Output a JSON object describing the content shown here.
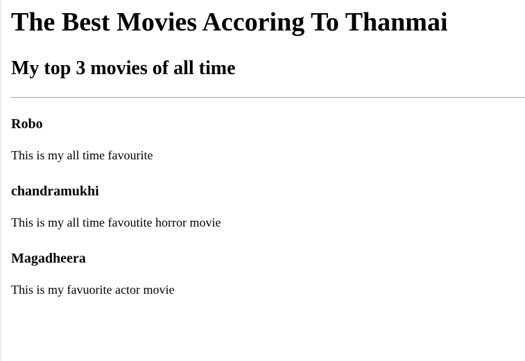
{
  "page": {
    "title": "The Best Movies Accoring To Thanmai",
    "subtitle": "My top 3 movies of all time"
  },
  "movies": [
    {
      "name": "Robo",
      "description": "This is my all time favourite"
    },
    {
      "name": "chandramukhi",
      "description": "This is my all time favoutite horror movie"
    },
    {
      "name": "Magadheera",
      "description": "This is my favuorite actor movie"
    }
  ]
}
